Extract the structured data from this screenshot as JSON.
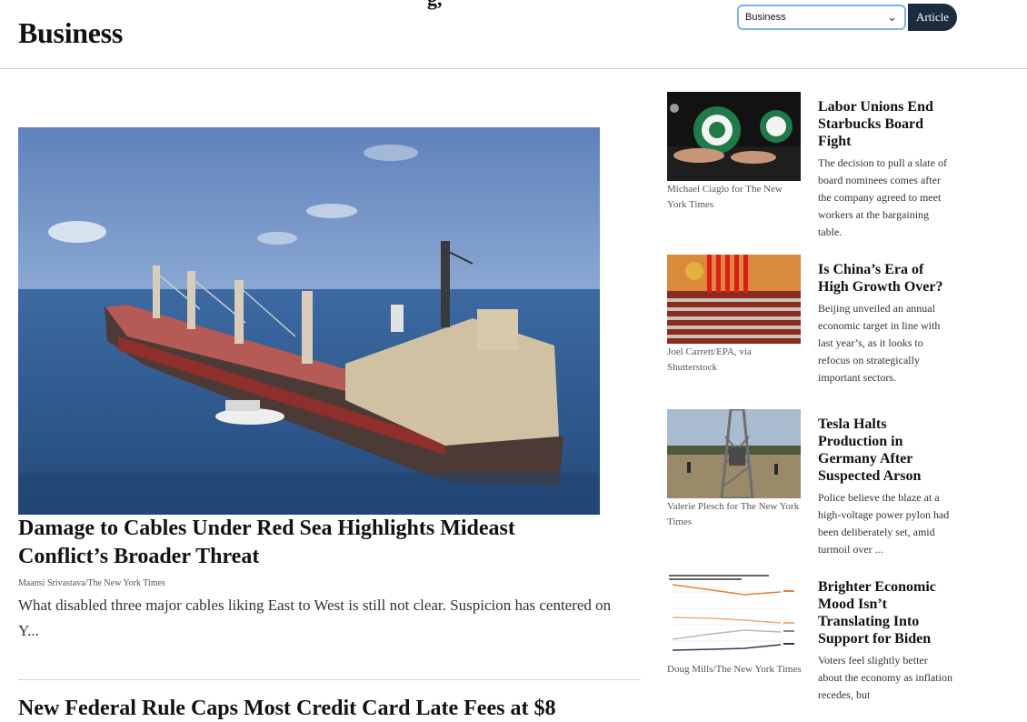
{
  "page": {
    "section_title": "Business",
    "top_clip": "g,"
  },
  "controls": {
    "select_value": "Business",
    "article_button": "Article"
  },
  "hero": {
    "headline": "Damage to Cables Under Red Sea Highlights Mideast Conflict’s Broader Threat",
    "credit": "Maansi Srivastava/The New York Times",
    "summary": "What disabled three major cables liking East to West is still not clear. Suspicion has centered on Y..."
  },
  "next_article": {
    "headline": "New Federal Rule Caps Most Credit Card Late Fees at $8"
  },
  "sidebar": {
    "items": [
      {
        "headline": "Labor Unions End Starbucks Board Fight",
        "summary": "The decision to pull a slate of board nominees comes after the company agreed to meet workers at the bargaining table.",
        "credit": "Michael Ciaglo for The New York Times",
        "image": "starbucks-workers-photo"
      },
      {
        "headline": "Is China’s Era of High Growth Over?",
        "summary": "Beijing unveiled an annual economic target in line with last year’s, as it looks to refocus on strategically important sectors.",
        "credit": "Joel Carrett/EPA, via Shutterstock",
        "image": "china-congress-hall-photo"
      },
      {
        "headline": "Tesla Halts Production in Germany After Suspected Arson",
        "summary": "Police believe the blaze at a high-voltage power pylon had been deliberately set, amid turmoil over ...",
        "credit": "Valerie Plesch for The New York Times",
        "image": "power-pylon-photo"
      },
      {
        "headline": "Brighter Economic Mood Isn’t Translating Into Support for Biden",
        "summary": "Voters feel slightly better about the economy as inflation recedes, but",
        "credit": "Doug Mills/The New York Times",
        "image": "economy-poll-chart"
      }
    ]
  },
  "colors": {
    "accent": "#1d2b3f",
    "rule": "#c9d5da",
    "select_border": "#7fb2ea"
  }
}
